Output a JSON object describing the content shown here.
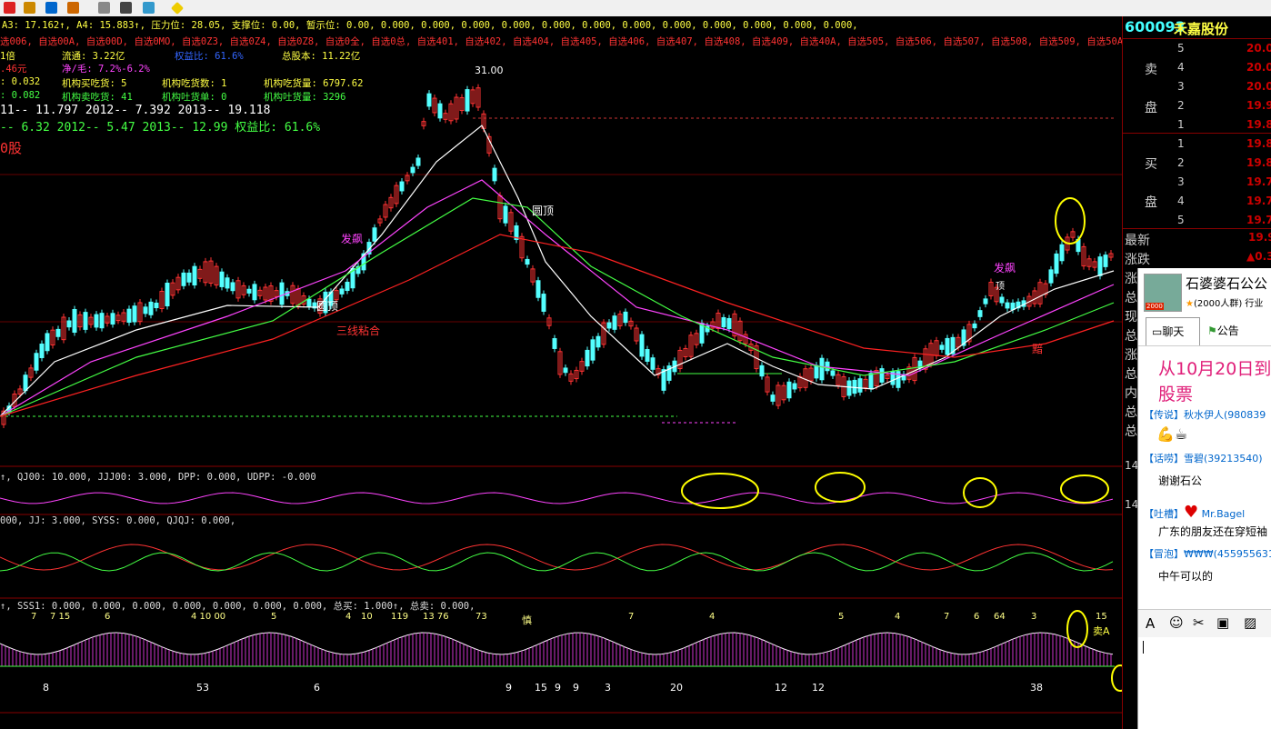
{
  "header": {
    "line1": "A3: 17.162↑, A4: 15.883↑, 压力位: 28.05, 支撑位: 0.00, 暂示位: 0.00, 0.000, 0.000, 0.000, 0.000, 0.000, 0.000, 0.000, 0.000, 0.000, 0.000, 0.000, 0.000,",
    "line2": "选006, 自选00A, 自选00D, 自选0MO, 自选0Z3, 自选0Z4, 自选0Z8, 自选0全, 自选0总, 自选401, 自选402, 自选404, 自选405, 自选406, 自选407, 自选408, 自选409, 自选40A, 自选505, 自选506, 自选507, 自选508, 自选509, 自选50A, 自选607, 自选608,",
    "info1a": "1倍",
    "info1b": "流通: 3.22亿",
    "info1c": "权益比: 61.6%",
    "info1d": "总股本: 11.22亿",
    "info2a": ".46元",
    "info2b": "净/毛: 7.2%-6.2%",
    "info3a": ": 0.032",
    "info3b": "机构买吃货: 5",
    "info3c": "机构吃货数: 1",
    "info3d": "机构吃货量: 6797.62",
    "info4a": ": 0.082",
    "info4b": "机构卖吃货: 41",
    "info4c": "机构吐货单: 0",
    "info4d": "机构吐货量: 3296",
    "eps": "11-- 11.797    2012-- 7.392    2013-- 19.118",
    "pe": "-- 6.32    2012-- 5.47    2013-- 12.99    权益比: 61.6%",
    "stock_label": "0股"
  },
  "chart_labels": {
    "peak": "31.00",
    "fa_piao_1": "发飙",
    "fa_piao_2": "发飙",
    "yuan_ding_1": "圆顶",
    "yuan_ding_2": "圆顶",
    "san_xian": "三线粘合",
    "ding": "顶",
    "an": "黯"
  },
  "indicators": {
    "ind1": "↑, QJ00: 10.000, JJJ00: 3.000, DPP: 0.000, UDPP: -0.000",
    "ind2": "000, JJ: 3.000, SYSS: 0.000, QJQJ: 0.000,",
    "ind3": "↑, SSS1: 0.000, 0.000, 0.000, 0.000, 0.000, 0.000, 0.000, 总买: 1.000↑, 总卖: 0.000,",
    "bottom_nums": [
      "8",
      "53",
      "6",
      "9",
      "15",
      "9",
      "9",
      "3",
      "20",
      "12",
      "12",
      "38"
    ],
    "top_nums": [
      "7",
      "7 15",
      "6",
      "4 10 00",
      "5",
      "4",
      "10",
      "119",
      "13 76",
      "73",
      "7",
      "4",
      "5",
      "4",
      "7",
      "6",
      "64",
      "3",
      "15"
    ],
    "shen": "慎",
    "mai_a": "卖A"
  },
  "quote": {
    "code": "600093",
    "name": "禾嘉股份",
    "sell_label_1": "卖",
    "sell_label_2": "盘",
    "buy_label_1": "买",
    "buy_label_2": "盘",
    "sell_levels": [
      {
        "level": "5",
        "price": "20.0"
      },
      {
        "level": "4",
        "price": "20.0"
      },
      {
        "level": "3",
        "price": "20.0"
      },
      {
        "level": "2",
        "price": "19.9"
      },
      {
        "level": "1",
        "price": "19.8"
      }
    ],
    "buy_levels": [
      {
        "level": "1",
        "price": "19.8"
      },
      {
        "level": "2",
        "price": "19.8"
      },
      {
        "level": "3",
        "price": "19.7"
      },
      {
        "level": "4",
        "price": "19.7"
      },
      {
        "level": "5",
        "price": "19.7"
      }
    ],
    "stats": [
      "最新",
      "涨跌",
      "涨",
      "总",
      "现",
      "总",
      "涨",
      "总",
      "内",
      "总",
      "总"
    ],
    "stat_vals": [
      "19.9",
      "▲0.3"
    ],
    "side_nums": [
      "14",
      "14"
    ]
  },
  "chat": {
    "group_name": "石婆婆石公公",
    "group_meta": "(2000人群) 行业",
    "tab_chat": "聊天",
    "tab_notice": "公告",
    "banner_1": "从10月20日到",
    "banner_2": "股票",
    "msg1_tag": "【传说】",
    "msg1_user": "秋水伊人(980839",
    "msg2_tag": "【话唠】",
    "msg2_user": "雪碧(39213540)",
    "msg2_text": "谢谢石公",
    "msg3_tag": "【吐槽】",
    "msg3_user": "Mr.Bagel",
    "msg3_text": "广东的朋友还在穿短袖",
    "msg4_tag": "【冒泡】",
    "msg4_user": "₩₩₩(455955631)",
    "msg4_text": "中午可以的",
    "avatar_badge": "2000"
  },
  "colors": {
    "up": "#ff3333",
    "down": "#54ffff",
    "ma_white": "#ffffff",
    "ma_magenta": "#ff44ff",
    "ma_green": "#44ff44",
    "ma_red": "#ff2222",
    "highlight": "#ffff00"
  }
}
